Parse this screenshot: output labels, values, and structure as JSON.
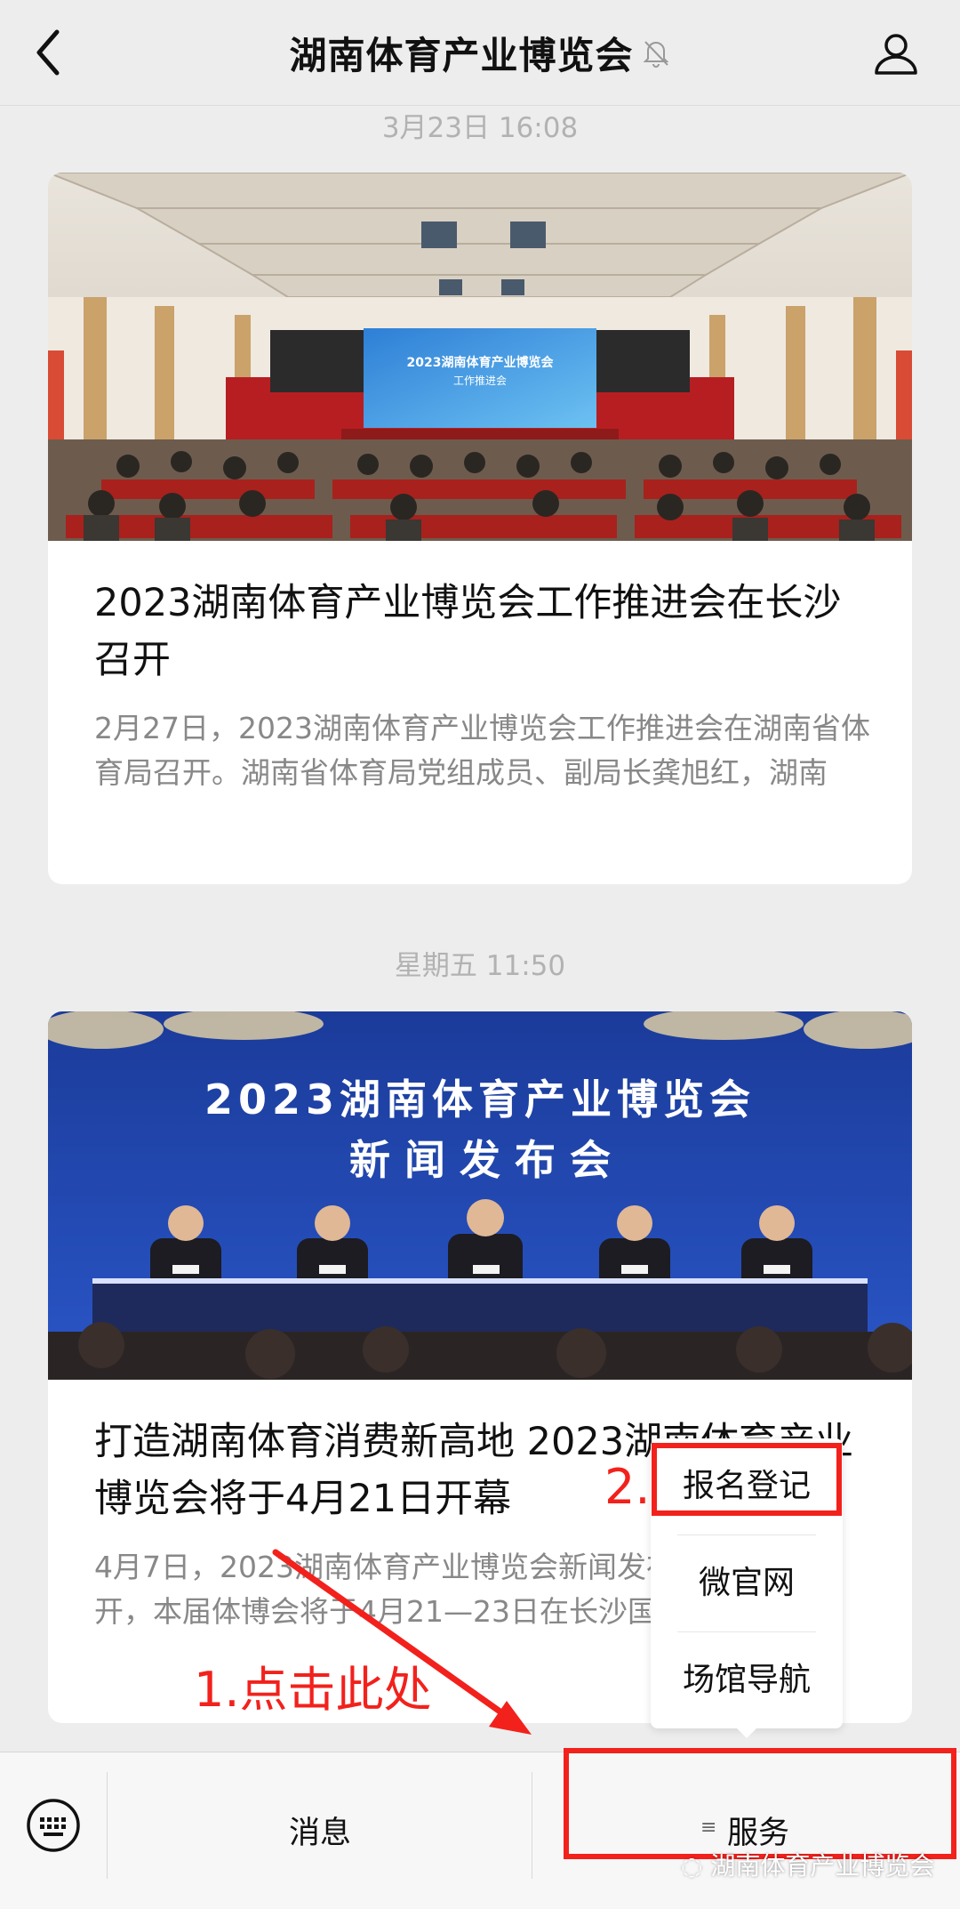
{
  "header": {
    "title": "湖南体育产业博览会",
    "back_icon": "back-chevron-icon",
    "mute_icon": "bell-muted-icon",
    "profile_icon": "person-icon"
  },
  "messages": [
    {
      "timestamp": "3月23日 16:08",
      "image": {
        "screen_text_1": "2023湖南体育产业博览会",
        "screen_text_2": "工作推进会"
      },
      "title": "2023湖南体育产业博览会工作推进会在长沙召开",
      "summary": "2月27日，2023湖南体育产业博览会工作推进会在湖南省体育局召开。湖南省体育局党组成员、副局长龚旭红，湖南"
    },
    {
      "timestamp": "星期五 11:50",
      "image": {
        "banner_line_1": "2023湖南体育产业博览会",
        "banner_line_2": "新 闻 发 布 会"
      },
      "title": "打造湖南体育消费新高地 2023湖南体育产业博览会将于4月21日开幕",
      "summary": "4月7日，2023湖南体育产业博览会新闻发布会在长沙召开，本届体博会将于4月21—23日在长沙国际会展中"
    }
  ],
  "popup_menu": {
    "items": [
      "报名登记",
      "微官网",
      "场馆导航"
    ]
  },
  "bottom_bar": {
    "keyboard_icon": "keyboard-icon",
    "tab_messages": "消息",
    "menu_lines": "≡",
    "tab_services": "服务"
  },
  "annotations": {
    "step1": "1.点击此处",
    "step2": "2.",
    "color": "#f2211c"
  },
  "watermark": "湖南体育产业博览会",
  "colors": {
    "background": "#ededed",
    "annotation_red": "#f2211c",
    "card_bg": "#ffffff"
  }
}
